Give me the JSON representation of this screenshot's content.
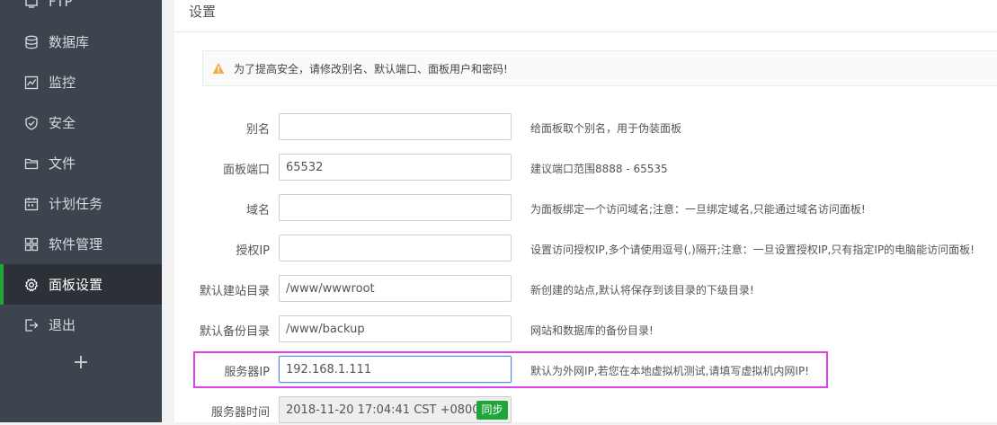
{
  "sidebar": {
    "items": [
      {
        "label": "FTP",
        "icon": "ftp-icon"
      },
      {
        "label": "数据库",
        "icon": "database-icon"
      },
      {
        "label": "监控",
        "icon": "monitor-icon"
      },
      {
        "label": "安全",
        "icon": "shield-icon"
      },
      {
        "label": "文件",
        "icon": "folder-icon"
      },
      {
        "label": "计划任务",
        "icon": "calendar-icon"
      },
      {
        "label": "软件管理",
        "icon": "grid-icon"
      },
      {
        "label": "面板设置",
        "icon": "gear-icon",
        "active": true
      },
      {
        "label": "退出",
        "icon": "logout-icon"
      }
    ],
    "add_label": "+"
  },
  "page": {
    "title": "设置",
    "alert": "为了提高安全，请修改别名、默认端口、面板用户和密码!"
  },
  "form": {
    "alias": {
      "label": "别名",
      "value": "",
      "hint": "给面板取个别名，用于伪装面板"
    },
    "port": {
      "label": "面板端口",
      "value": "65532",
      "hint": "建议端口范围8888 - 65535"
    },
    "domain": {
      "label": "域名",
      "value": "",
      "hint": "为面板绑定一个访问域名;注意：一旦绑定域名,只能通过域名访问面板!"
    },
    "auth_ip": {
      "label": "授权IP",
      "value": "",
      "hint": "设置访问授权IP,多个请使用逗号(,)隔开;注意：一旦设置授权IP,只有指定IP的电脑能访问面板!"
    },
    "site_dir": {
      "label": "默认建站目录",
      "value": "/www/wwwroot",
      "hint": "新创建的站点,默认将保存到该目录的下级目录!"
    },
    "backup_dir": {
      "label": "默认备份目录",
      "value": "/www/backup",
      "hint": "网站和数据库的备份目录!"
    },
    "server_ip": {
      "label": "服务器IP",
      "value": "192.168.1.111",
      "hint": "默认为外网IP,若您在本地虚拟机测试,请填写虚拟机内网IP!"
    },
    "server_time": {
      "label": "服务器时间",
      "value": "2018-11-20 17:04:41 CST +0800",
      "sync_label": "同步"
    }
  },
  "colors": {
    "sidebar_bg": "#3c444d",
    "sidebar_active_bg": "#2c3138",
    "accent_green": "#20a53a",
    "warning_orange": "#f0ad4e",
    "highlight_magenta": "#e040e8"
  }
}
